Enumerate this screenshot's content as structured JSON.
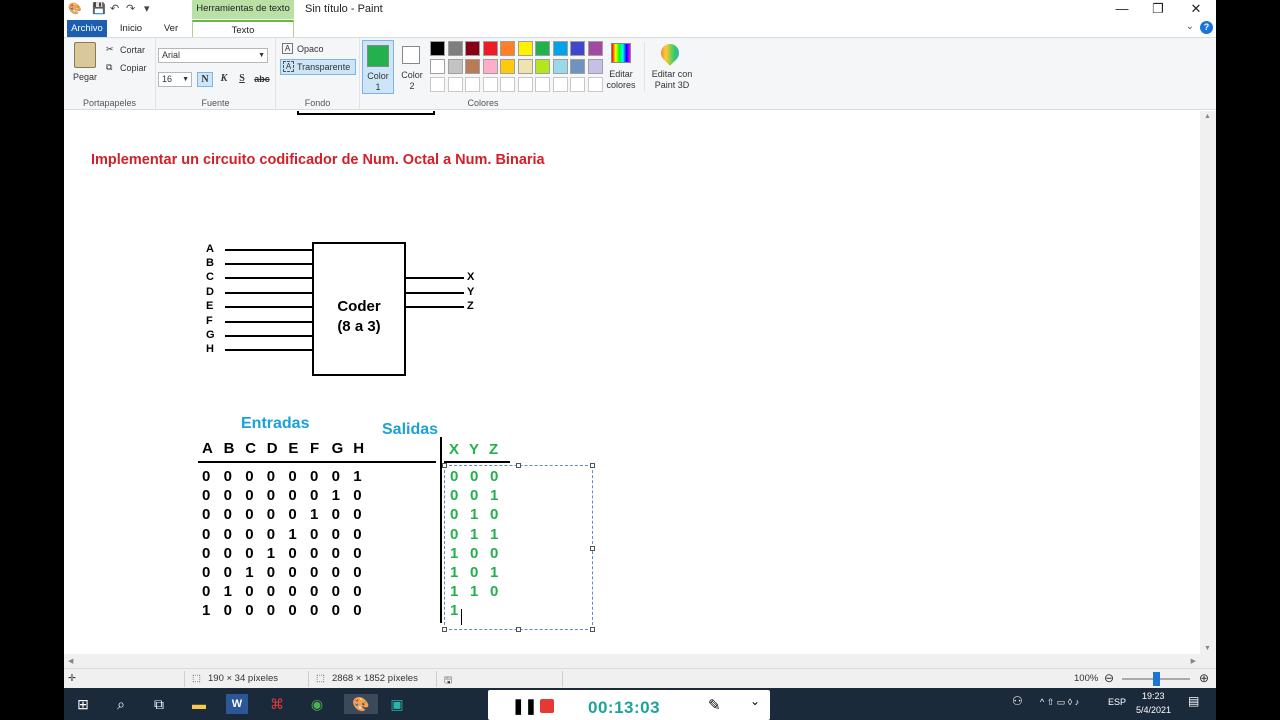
{
  "titlebar": {
    "context_tab": "Herramientas de texto",
    "title": "Sin título - Paint",
    "minimize": "—",
    "restore": "❐",
    "close": "✕"
  },
  "tabs": {
    "archivo": "Archivo",
    "inicio": "Inicio",
    "ver": "Ver",
    "texto": "Texto"
  },
  "ribbon": {
    "portapapeles": {
      "pegar": "Pegar",
      "cortar": "Cortar",
      "copiar": "Copiar",
      "label": "Portapapeles"
    },
    "fuente": {
      "font": "Arial",
      "size": "16",
      "bold": "N",
      "italic": "K",
      "underline": "S",
      "strike": "abc",
      "label": "Fuente"
    },
    "fondo": {
      "opaco": "Opaco",
      "transparente": "Transparente",
      "label": "Fondo"
    },
    "colores": {
      "color1": "Color 1",
      "color1_line1": "Color",
      "color1_line2": "1",
      "color2_line1": "Color",
      "color2_line2": "2",
      "color1_hex": "#22b14c",
      "color2_hex": "#ffffff",
      "palette_row1": [
        "#000000",
        "#7f7f7f",
        "#880015",
        "#ed1c24",
        "#ff7f27",
        "#fff200",
        "#22b14c",
        "#00a2e8",
        "#3f48cc",
        "#a349a4"
      ],
      "palette_row2": [
        "#ffffff",
        "#c3c3c3",
        "#b97a57",
        "#ffaec9",
        "#ffc90e",
        "#efe4b0",
        "#b5e61d",
        "#99d9ea",
        "#7092be",
        "#c8bfe7"
      ],
      "editar_line1": "Editar",
      "editar_line2": "colores",
      "paint3d_line1": "Editar con",
      "paint3d_line2": "Paint 3D",
      "label": "Colores"
    }
  },
  "canvas": {
    "heading": "Implementar un circuito codificador de Num. Octal a Num. Binaria",
    "heading_color": "#d32027",
    "inputs": [
      "A",
      "B",
      "C",
      "D",
      "E",
      "F",
      "G",
      "H"
    ],
    "outputs": [
      "X",
      "Y",
      "Z"
    ],
    "box_line1": "Coder",
    "box_line2": "(8 a 3)",
    "entradas_label": "Entradas",
    "salidas_label": "Salidas",
    "label_color": "#1ba1d6",
    "output_color": "#22b14c",
    "in_headers": [
      "A",
      "B",
      "C",
      "D",
      "E",
      "F",
      "G",
      "H"
    ],
    "out_headers": [
      "X",
      "Y",
      "Z"
    ],
    "rows_in": [
      "0 0 0 0 0 0 0 1",
      "0 0 0 0 0 0 1 0",
      "0 0 0 0 0 1 0 0",
      "0 0 0 0 1 0 0 0",
      "0 0 0 1 0 0 0 0",
      "0 0 1 0 0 0 0 0",
      "0 1 0 0 0 0 0 0",
      "1 0 0 0 0 0 0 0"
    ],
    "rows_out": [
      "0 0 0",
      "0 0 1",
      "0 1 0",
      "0 1 1",
      "1 0 0",
      "1 0 1",
      "1 1 0",
      "1"
    ]
  },
  "statusbar": {
    "selection_size": "190 × 34 píxeles",
    "image_size": "2868 × 1852 píxeles",
    "zoom": "100%",
    "zoom_fraction": 0.5
  },
  "taskbar": {
    "timer": "00:13:03",
    "lang": "ESP",
    "time": "19:23",
    "date": "5/4/2021"
  }
}
